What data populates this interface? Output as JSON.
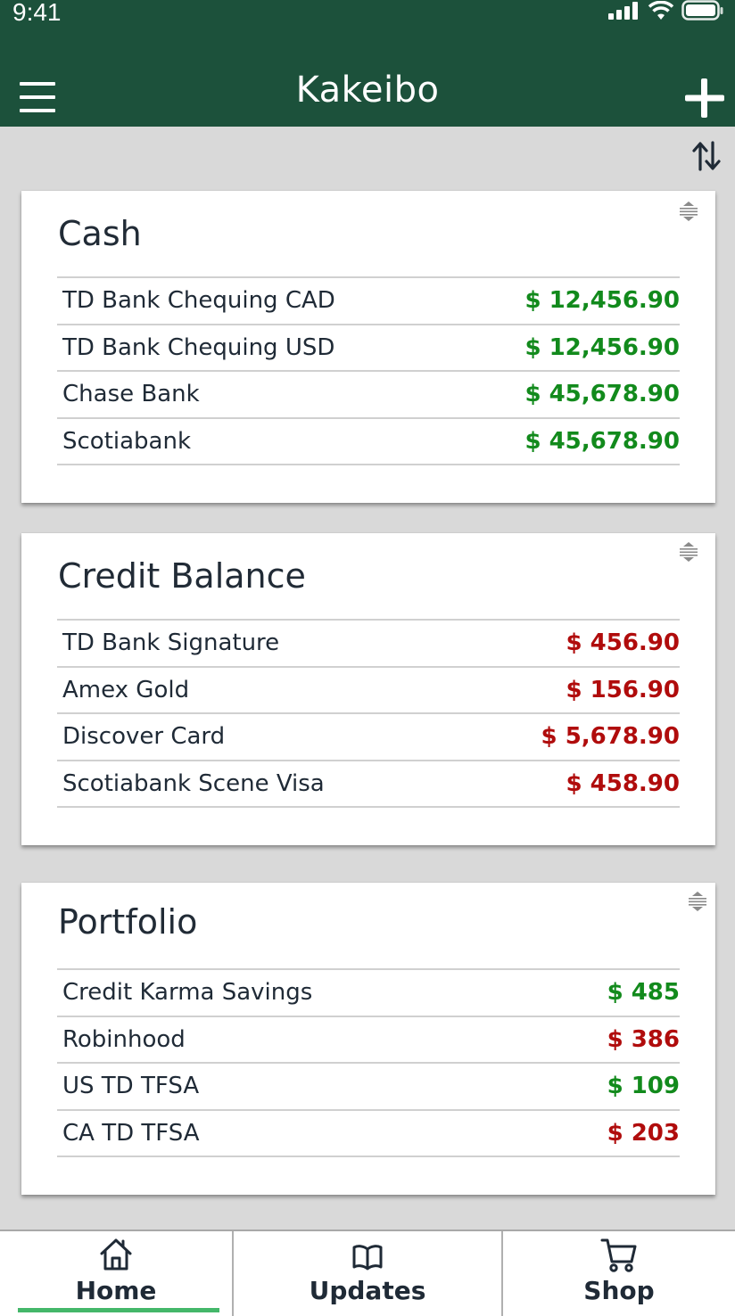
{
  "status_bar": {
    "time": "9:41"
  },
  "header": {
    "title": "Kakeibo"
  },
  "colors": {
    "brand": "#1c513b",
    "positive": "#128a1c",
    "negative": "#b00c0c",
    "tab_active": "#44b76a"
  },
  "icons": {
    "menu": "hamburger-menu-icon",
    "add": "plus-icon",
    "sort": "sort-arrows-icon",
    "drag": "drag-handle-icon"
  },
  "sections": [
    {
      "title": "Cash",
      "rows": [
        {
          "name": "TD Bank Chequing CAD",
          "amount": "$ 12,456.90",
          "sign": "positive"
        },
        {
          "name": "TD Bank Chequing USD",
          "amount": "$ 12,456.90",
          "sign": "positive"
        },
        {
          "name": "Chase Bank",
          "amount": "$ 45,678.90",
          "sign": "positive"
        },
        {
          "name": "Scotiabank",
          "amount": "$ 45,678.90",
          "sign": "positive"
        }
      ]
    },
    {
      "title": "Credit Balance",
      "rows": [
        {
          "name": "TD Bank Signature",
          "amount": "$ 456.90",
          "sign": "negative"
        },
        {
          "name": "Amex Gold",
          "amount": "$ 156.90",
          "sign": "negative"
        },
        {
          "name": "Discover Card",
          "amount": "$ 5,678.90",
          "sign": "negative"
        },
        {
          "name": "Scotiabank Scene Visa",
          "amount": "$ 458.90",
          "sign": "negative"
        }
      ]
    },
    {
      "title": "Portfolio",
      "rows": [
        {
          "name": "Credit Karma Savings",
          "amount": "$ 485",
          "sign": "positive"
        },
        {
          "name": "Robinhood",
          "amount": "$ 386",
          "sign": "negative"
        },
        {
          "name": "US TD TFSA",
          "amount": "$ 109",
          "sign": "positive"
        },
        {
          "name": "CA TD TFSA",
          "amount": "$ 203",
          "sign": "negative"
        }
      ]
    }
  ],
  "tabs": [
    {
      "label": "Home",
      "icon": "home-icon",
      "active": true
    },
    {
      "label": "Updates",
      "icon": "book-icon",
      "active": false
    },
    {
      "label": "Shop",
      "icon": "cart-icon",
      "active": false
    }
  ]
}
